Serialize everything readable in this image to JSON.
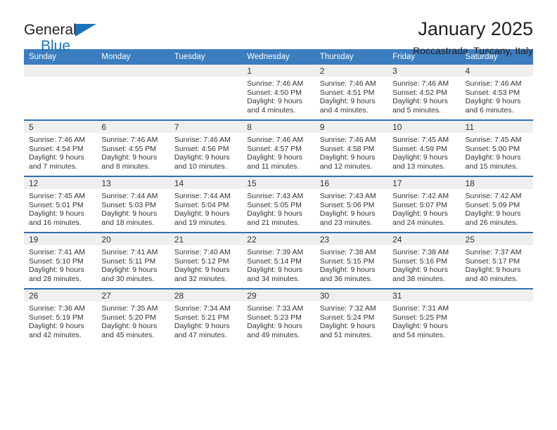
{
  "brand": {
    "line1": "General",
    "line2": "Blue",
    "accent_color": "#1b75bb",
    "logo_icon": "triangle-icon"
  },
  "header": {
    "title": "January 2025",
    "subtitle": "Roccastrada, Tuscany, Italy"
  },
  "calendar": {
    "header_bg": "#3b7dbf",
    "row_rule_color": "#2f6fb0",
    "daynum_bg": "#efefef",
    "weekdays": [
      "Sunday",
      "Monday",
      "Tuesday",
      "Wednesday",
      "Thursday",
      "Friday",
      "Saturday"
    ],
    "labels": {
      "sunrise": "Sunrise:",
      "sunset": "Sunset:",
      "daylight": "Daylight:"
    },
    "weeks": [
      [
        {
          "day": ""
        },
        {
          "day": ""
        },
        {
          "day": ""
        },
        {
          "day": "1",
          "sunrise": "Sunrise: 7:46 AM",
          "sunset": "Sunset: 4:50 PM",
          "daylight1": "Daylight: 9 hours",
          "daylight2": "and 4 minutes."
        },
        {
          "day": "2",
          "sunrise": "Sunrise: 7:46 AM",
          "sunset": "Sunset: 4:51 PM",
          "daylight1": "Daylight: 9 hours",
          "daylight2": "and 4 minutes."
        },
        {
          "day": "3",
          "sunrise": "Sunrise: 7:46 AM",
          "sunset": "Sunset: 4:52 PM",
          "daylight1": "Daylight: 9 hours",
          "daylight2": "and 5 minutes."
        },
        {
          "day": "4",
          "sunrise": "Sunrise: 7:46 AM",
          "sunset": "Sunset: 4:53 PM",
          "daylight1": "Daylight: 9 hours",
          "daylight2": "and 6 minutes."
        }
      ],
      [
        {
          "day": "5",
          "sunrise": "Sunrise: 7:46 AM",
          "sunset": "Sunset: 4:54 PM",
          "daylight1": "Daylight: 9 hours",
          "daylight2": "and 7 minutes."
        },
        {
          "day": "6",
          "sunrise": "Sunrise: 7:46 AM",
          "sunset": "Sunset: 4:55 PM",
          "daylight1": "Daylight: 9 hours",
          "daylight2": "and 8 minutes."
        },
        {
          "day": "7",
          "sunrise": "Sunrise: 7:46 AM",
          "sunset": "Sunset: 4:56 PM",
          "daylight1": "Daylight: 9 hours",
          "daylight2": "and 10 minutes."
        },
        {
          "day": "8",
          "sunrise": "Sunrise: 7:46 AM",
          "sunset": "Sunset: 4:57 PM",
          "daylight1": "Daylight: 9 hours",
          "daylight2": "and 11 minutes."
        },
        {
          "day": "9",
          "sunrise": "Sunrise: 7:46 AM",
          "sunset": "Sunset: 4:58 PM",
          "daylight1": "Daylight: 9 hours",
          "daylight2": "and 12 minutes."
        },
        {
          "day": "10",
          "sunrise": "Sunrise: 7:45 AM",
          "sunset": "Sunset: 4:59 PM",
          "daylight1": "Daylight: 9 hours",
          "daylight2": "and 13 minutes."
        },
        {
          "day": "11",
          "sunrise": "Sunrise: 7:45 AM",
          "sunset": "Sunset: 5:00 PM",
          "daylight1": "Daylight: 9 hours",
          "daylight2": "and 15 minutes."
        }
      ],
      [
        {
          "day": "12",
          "sunrise": "Sunrise: 7:45 AM",
          "sunset": "Sunset: 5:01 PM",
          "daylight1": "Daylight: 9 hours",
          "daylight2": "and 16 minutes."
        },
        {
          "day": "13",
          "sunrise": "Sunrise: 7:44 AM",
          "sunset": "Sunset: 5:03 PM",
          "daylight1": "Daylight: 9 hours",
          "daylight2": "and 18 minutes."
        },
        {
          "day": "14",
          "sunrise": "Sunrise: 7:44 AM",
          "sunset": "Sunset: 5:04 PM",
          "daylight1": "Daylight: 9 hours",
          "daylight2": "and 19 minutes."
        },
        {
          "day": "15",
          "sunrise": "Sunrise: 7:43 AM",
          "sunset": "Sunset: 5:05 PM",
          "daylight1": "Daylight: 9 hours",
          "daylight2": "and 21 minutes."
        },
        {
          "day": "16",
          "sunrise": "Sunrise: 7:43 AM",
          "sunset": "Sunset: 5:06 PM",
          "daylight1": "Daylight: 9 hours",
          "daylight2": "and 23 minutes."
        },
        {
          "day": "17",
          "sunrise": "Sunrise: 7:42 AM",
          "sunset": "Sunset: 5:07 PM",
          "daylight1": "Daylight: 9 hours",
          "daylight2": "and 24 minutes."
        },
        {
          "day": "18",
          "sunrise": "Sunrise: 7:42 AM",
          "sunset": "Sunset: 5:09 PM",
          "daylight1": "Daylight: 9 hours",
          "daylight2": "and 26 minutes."
        }
      ],
      [
        {
          "day": "19",
          "sunrise": "Sunrise: 7:41 AM",
          "sunset": "Sunset: 5:10 PM",
          "daylight1": "Daylight: 9 hours",
          "daylight2": "and 28 minutes."
        },
        {
          "day": "20",
          "sunrise": "Sunrise: 7:41 AM",
          "sunset": "Sunset: 5:11 PM",
          "daylight1": "Daylight: 9 hours",
          "daylight2": "and 30 minutes."
        },
        {
          "day": "21",
          "sunrise": "Sunrise: 7:40 AM",
          "sunset": "Sunset: 5:12 PM",
          "daylight1": "Daylight: 9 hours",
          "daylight2": "and 32 minutes."
        },
        {
          "day": "22",
          "sunrise": "Sunrise: 7:39 AM",
          "sunset": "Sunset: 5:14 PM",
          "daylight1": "Daylight: 9 hours",
          "daylight2": "and 34 minutes."
        },
        {
          "day": "23",
          "sunrise": "Sunrise: 7:38 AM",
          "sunset": "Sunset: 5:15 PM",
          "daylight1": "Daylight: 9 hours",
          "daylight2": "and 36 minutes."
        },
        {
          "day": "24",
          "sunrise": "Sunrise: 7:38 AM",
          "sunset": "Sunset: 5:16 PM",
          "daylight1": "Daylight: 9 hours",
          "daylight2": "and 38 minutes."
        },
        {
          "day": "25",
          "sunrise": "Sunrise: 7:37 AM",
          "sunset": "Sunset: 5:17 PM",
          "daylight1": "Daylight: 9 hours",
          "daylight2": "and 40 minutes."
        }
      ],
      [
        {
          "day": "26",
          "sunrise": "Sunrise: 7:36 AM",
          "sunset": "Sunset: 5:19 PM",
          "daylight1": "Daylight: 9 hours",
          "daylight2": "and 42 minutes."
        },
        {
          "day": "27",
          "sunrise": "Sunrise: 7:35 AM",
          "sunset": "Sunset: 5:20 PM",
          "daylight1": "Daylight: 9 hours",
          "daylight2": "and 45 minutes."
        },
        {
          "day": "28",
          "sunrise": "Sunrise: 7:34 AM",
          "sunset": "Sunset: 5:21 PM",
          "daylight1": "Daylight: 9 hours",
          "daylight2": "and 47 minutes."
        },
        {
          "day": "29",
          "sunrise": "Sunrise: 7:33 AM",
          "sunset": "Sunset: 5:23 PM",
          "daylight1": "Daylight: 9 hours",
          "daylight2": "and 49 minutes."
        },
        {
          "day": "30",
          "sunrise": "Sunrise: 7:32 AM",
          "sunset": "Sunset: 5:24 PM",
          "daylight1": "Daylight: 9 hours",
          "daylight2": "and 51 minutes."
        },
        {
          "day": "31",
          "sunrise": "Sunrise: 7:31 AM",
          "sunset": "Sunset: 5:25 PM",
          "daylight1": "Daylight: 9 hours",
          "daylight2": "and 54 minutes."
        },
        {
          "day": ""
        }
      ]
    ]
  }
}
